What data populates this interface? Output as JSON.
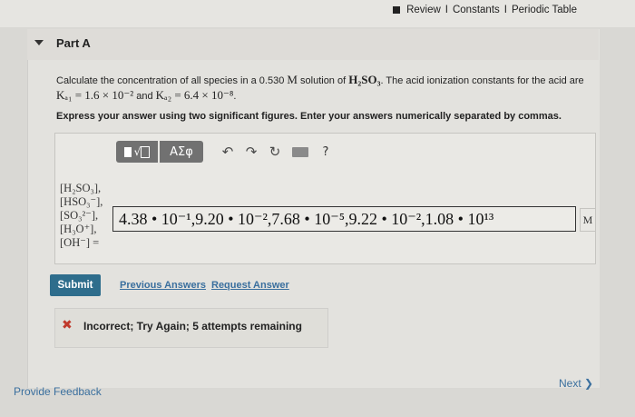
{
  "header": {
    "links": [
      "Review",
      "Constants",
      "Periodic Table"
    ],
    "separator": "I"
  },
  "part": {
    "title": "Part A"
  },
  "question": {
    "line1_prefix": "Calculate the concentration of all species in a 0.530 ",
    "line1_unit": "M",
    "line1_mid": " solution of ",
    "line1_formula": "H₂SO₃",
    "line1_suffix": ". The acid ionization constants for the acid are",
    "ka1": "Kₐ₁ = 1.6 × 10⁻²",
    "and": " and ",
    "ka2": "Kₐ₂ = 6.4 × 10⁻⁸",
    "end": "."
  },
  "instruction": "Express your answer using two significant figures. Enter your answers numerically separated by commas.",
  "toolbar": {
    "greek_label": "ΑΣφ",
    "undo_glyph": "↶",
    "redo_glyph": "↷",
    "reset_glyph": "↻",
    "help_label": "?"
  },
  "species_labels": [
    "[H₂SO₃],",
    "[HSO₃⁻],",
    "[SO₃²⁻],",
    "[H₃O⁺],",
    "[OH⁻] ="
  ],
  "answer": {
    "value": "4.38 • 10⁻¹,9.20 • 10⁻²,7.68 • 10⁻⁵,9.22 • 10⁻²,1.08 • 10¹³",
    "unit": "M"
  },
  "actions": {
    "submit": "Submit",
    "previous_answers": "Previous Answers",
    "request_answer": "Request Answer"
  },
  "feedback": {
    "message": "Incorrect; Try Again; 5 attempts remaining"
  },
  "footer": {
    "provide_feedback": "Provide Feedback",
    "next": "Next ❯"
  },
  "colors": {
    "submit_bg": "#2e6d8c",
    "link": "#3a6f9e",
    "error": "#c0392b"
  }
}
